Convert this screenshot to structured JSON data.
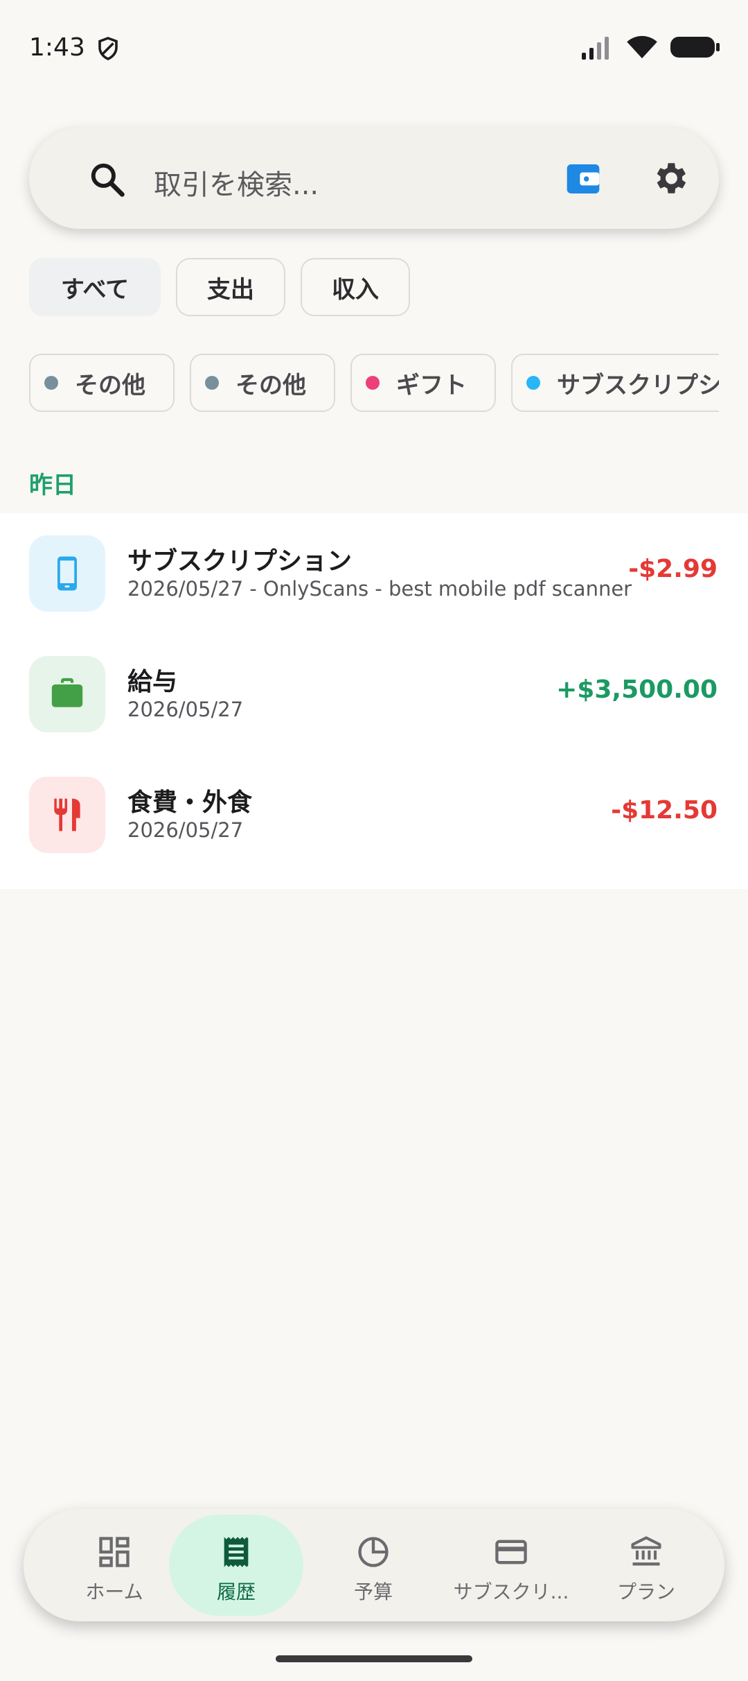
{
  "status_bar": {
    "time": "1:43"
  },
  "search": {
    "placeholder": "取引を検索..."
  },
  "type_filters": [
    {
      "label": "すべて",
      "selected": true
    },
    {
      "label": "支出",
      "selected": false
    },
    {
      "label": "収入",
      "selected": false
    }
  ],
  "category_filters": [
    {
      "label": "その他",
      "color": "#78909C"
    },
    {
      "label": "その他",
      "color": "#78909C"
    },
    {
      "label": "ギフト",
      "color": "#EC407A"
    },
    {
      "label": "サブスクリプション",
      "color": "#29B6F6"
    }
  ],
  "section": {
    "label": "昨日"
  },
  "transactions": [
    {
      "title": "サブスクリプション",
      "subtitle": "2026/05/27 - OnlyScans - best mobile pdf scanner",
      "amount": "-$2.99",
      "amount_color": "#E53935",
      "icon": "phone-icon",
      "icon_bg": "#E3F4FD",
      "icon_color": "#29A9EC"
    },
    {
      "title": "給与",
      "subtitle": "2026/05/27",
      "amount": "+$3,500.00",
      "amount_color": "#1B9A63",
      "icon": "briefcase-icon",
      "icon_bg": "#E6F4EA",
      "icon_color": "#43A047"
    },
    {
      "title": "食費・外食",
      "subtitle": "2026/05/27",
      "amount": "-$12.50",
      "amount_color": "#E53935",
      "icon": "fork-knife-icon",
      "icon_bg": "#FDE7E7",
      "icon_color": "#E53935"
    }
  ],
  "nav": [
    {
      "label": "ホーム",
      "icon": "dashboard-icon",
      "active": false
    },
    {
      "label": "履歴",
      "icon": "receipt-icon",
      "active": true
    },
    {
      "label": "予算",
      "icon": "pie-chart-icon",
      "active": false
    },
    {
      "label": "サブスクリ...",
      "icon": "credit-card-icon",
      "active": false
    },
    {
      "label": "プラン",
      "icon": "bank-icon",
      "active": false
    }
  ]
}
